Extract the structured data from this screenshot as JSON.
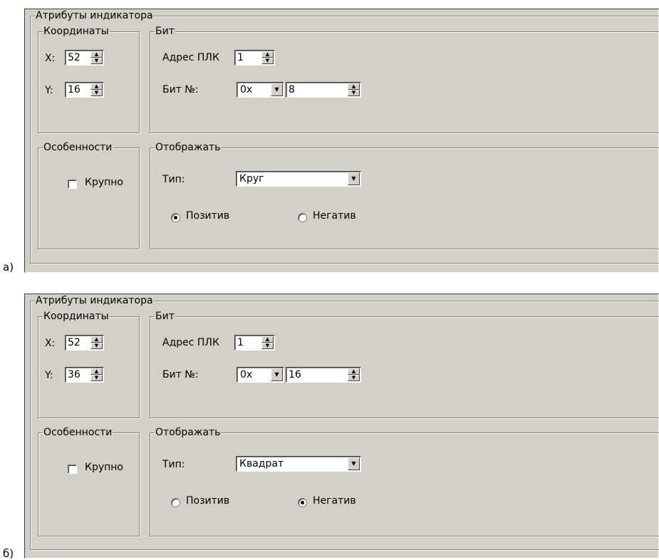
{
  "panels": [
    {
      "figure_label": "а)",
      "group_title": "Атрибуты индикатора",
      "coords": {
        "title": "Координаты",
        "x_label": "X:",
        "x_value": "52",
        "y_label": "Y:",
        "y_value": "16"
      },
      "bit": {
        "title": "Бит",
        "plc_label": "Адрес ПЛК",
        "plc_value": "1",
        "bit_label": "Бит №:",
        "base_value": "0x",
        "bit_value": "8"
      },
      "features": {
        "title": "Особенности",
        "large_label": "Крупно",
        "large_checked": false
      },
      "display": {
        "title": "Отображать",
        "type_label": "Тип:",
        "type_value": "Круг",
        "positive_label": "Позитив",
        "negative_label": "Негатив",
        "selected": "positive"
      }
    },
    {
      "figure_label": "б)",
      "group_title": "Атрибуты индикатора",
      "coords": {
        "title": "Координаты",
        "x_label": "X:",
        "x_value": "52",
        "y_label": "Y:",
        "y_value": "36"
      },
      "bit": {
        "title": "Бит",
        "plc_label": "Адрес ПЛК",
        "plc_value": "1",
        "bit_label": "Бит №:",
        "base_value": "0x",
        "bit_value": "16"
      },
      "features": {
        "title": "Особенности",
        "large_label": "Крупно",
        "large_checked": false
      },
      "display": {
        "title": "Отображать",
        "type_label": "Тип:",
        "type_value": "Квадрат",
        "positive_label": "Позитив",
        "negative_label": "Негатив",
        "selected": "negative"
      }
    }
  ]
}
